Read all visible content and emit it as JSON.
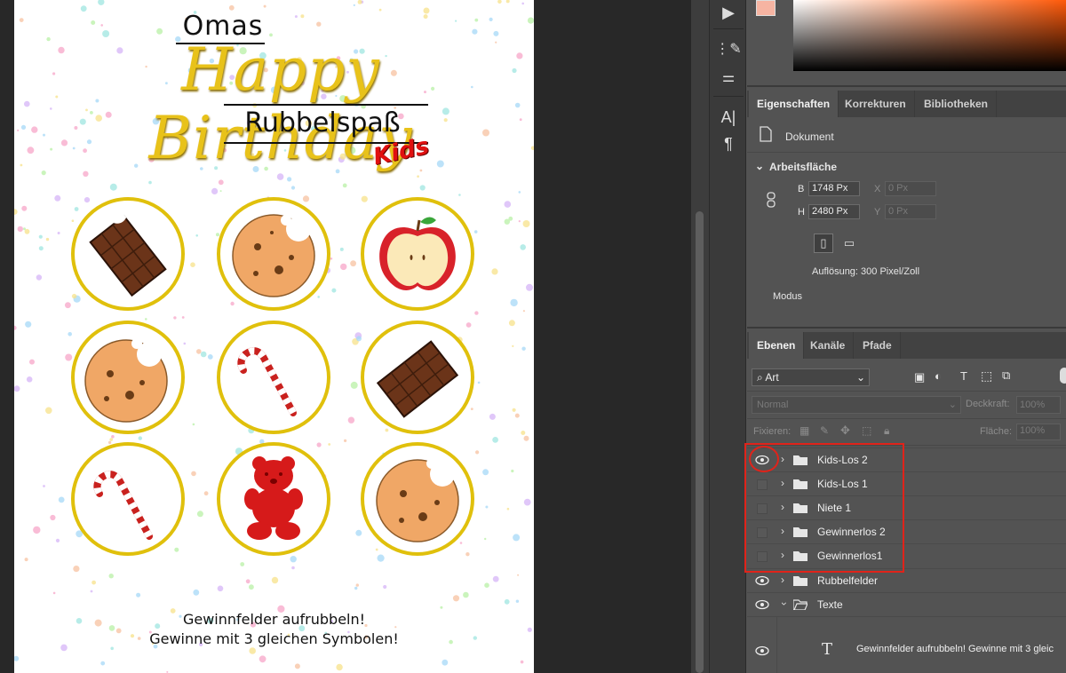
{
  "document": {
    "title_omas": "Omas",
    "title_main": "Happy Birthday",
    "title_rubbel": "Rubbelspaß",
    "title_kids": "Kids",
    "footer_line1": "Gewinnfelder aufrubbeln!",
    "footer_line2": "Gewinne mit 3 gleichen Symbolen!",
    "scratch_fields": [
      "chocolate-bar",
      "cookie",
      "apple",
      "cookie",
      "candy-cane",
      "chocolate-bar",
      "candy-cane",
      "gummy-bear",
      "cookie"
    ],
    "accent_gold": "#e0c00c"
  },
  "properties_panel": {
    "tabs": [
      "Eigenschaften",
      "Korrekturen",
      "Bibliotheken"
    ],
    "doc_label": "Dokument",
    "section": "Arbeitsfläche",
    "width_label": "B",
    "width_value": "1748 Px",
    "height_label": "H",
    "height_value": "2480 Px",
    "x_label": "X",
    "x_placeholder": "0 Px",
    "y_label": "Y",
    "y_placeholder": "0 Px",
    "resolution": "Auflösung: 300 Pixel/Zoll",
    "mode_label": "Modus"
  },
  "layers_panel": {
    "tabs": [
      "Ebenen",
      "Kanäle",
      "Pfade"
    ],
    "filter_value": "Art",
    "blend_mode": "Normal",
    "opacity_label": "Deckkraft:",
    "opacity_value": "100%",
    "lock_label": "Fixieren:",
    "fill_label": "Fläche:",
    "fill_value": "100%",
    "layers": [
      {
        "name": "Kids-Los 2",
        "visible": true,
        "type": "folder"
      },
      {
        "name": "Kids-Los 1",
        "visible": false,
        "type": "folder"
      },
      {
        "name": "Niete 1",
        "visible": false,
        "type": "folder"
      },
      {
        "name": "Gewinnerlos 2",
        "visible": false,
        "type": "folder"
      },
      {
        "name": "Gewinnerlos1",
        "visible": false,
        "type": "folder"
      },
      {
        "name": "Rubbelfelder",
        "visible": true,
        "type": "folder"
      },
      {
        "name": "Texte",
        "visible": true,
        "type": "folder-open"
      }
    ],
    "text_layer_name": "Gewinnfelder aufrubbeln!  Gewinne mit 3 gleic",
    "highlight_color": "#e0231a"
  },
  "colors": {
    "foreground": "#f6b4a2",
    "background": "#f5c9d9"
  }
}
